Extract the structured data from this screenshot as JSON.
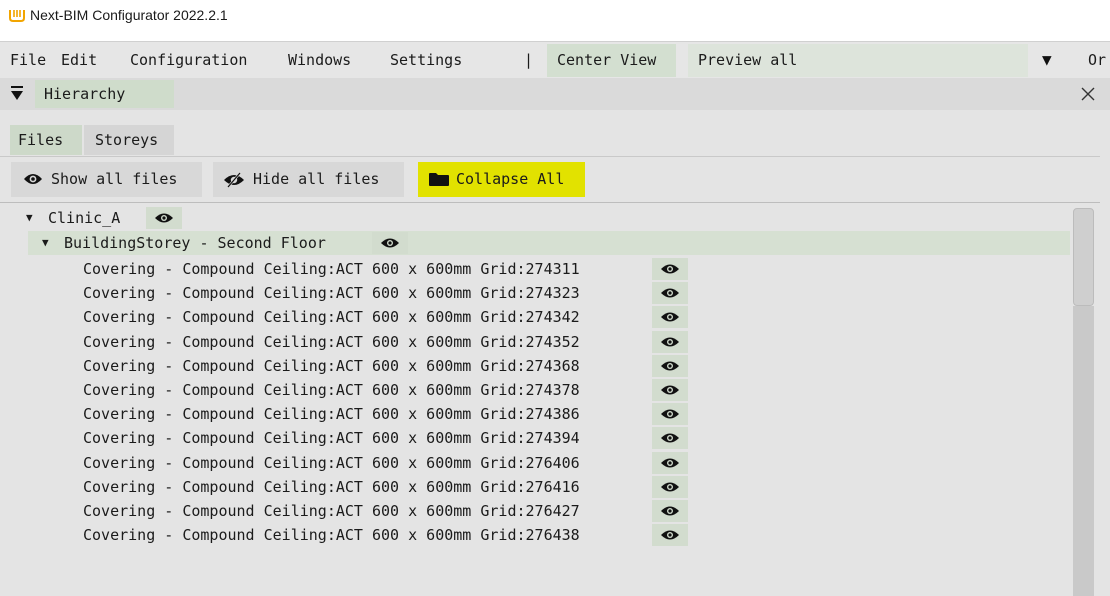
{
  "window": {
    "title": "Next-BIM Configurator 2022.2.1",
    "icon": "next-bim-logo-icon"
  },
  "menubar": {
    "items": [
      "File",
      "Edit",
      "Configuration",
      "Windows",
      "Settings"
    ],
    "separator": "|",
    "center_view": "Center View",
    "preview_all": "Preview all",
    "dropdown_icon": "▼",
    "overflow_text": "Or"
  },
  "panel": {
    "title": "Hierarchy",
    "collapse_icon": "panel-collapse-icon",
    "close_icon": "close-icon"
  },
  "tabs": [
    {
      "label": "Files",
      "active": true
    },
    {
      "label": "Storeys",
      "active": false
    }
  ],
  "actions": {
    "show_all": "Show all files",
    "hide_all": "Hide all files",
    "collapse_all": "Collapse All"
  },
  "colors": {
    "accent_highlight": "#e2e200",
    "active_green": "#cdd9c9"
  },
  "tree": {
    "root": {
      "label": "Clinic_A"
    },
    "storey": {
      "label": "BuildingStorey - Second Floor"
    },
    "items": [
      "Covering - Compound Ceiling:ACT 600 x 600mm Grid:274311",
      "Covering - Compound Ceiling:ACT 600 x 600mm Grid:274323",
      "Covering - Compound Ceiling:ACT 600 x 600mm Grid:274342",
      "Covering - Compound Ceiling:ACT 600 x 600mm Grid:274352",
      "Covering - Compound Ceiling:ACT 600 x 600mm Grid:274368",
      "Covering - Compound Ceiling:ACT 600 x 600mm Grid:274378",
      "Covering - Compound Ceiling:ACT 600 x 600mm Grid:274386",
      "Covering - Compound Ceiling:ACT 600 x 600mm Grid:274394",
      "Covering - Compound Ceiling:ACT 600 x 600mm Grid:276406",
      "Covering - Compound Ceiling:ACT 600 x 600mm Grid:276416",
      "Covering - Compound Ceiling:ACT 600 x 600mm Grid:276427",
      "Covering - Compound Ceiling:ACT 600 x 600mm Grid:276438"
    ]
  }
}
